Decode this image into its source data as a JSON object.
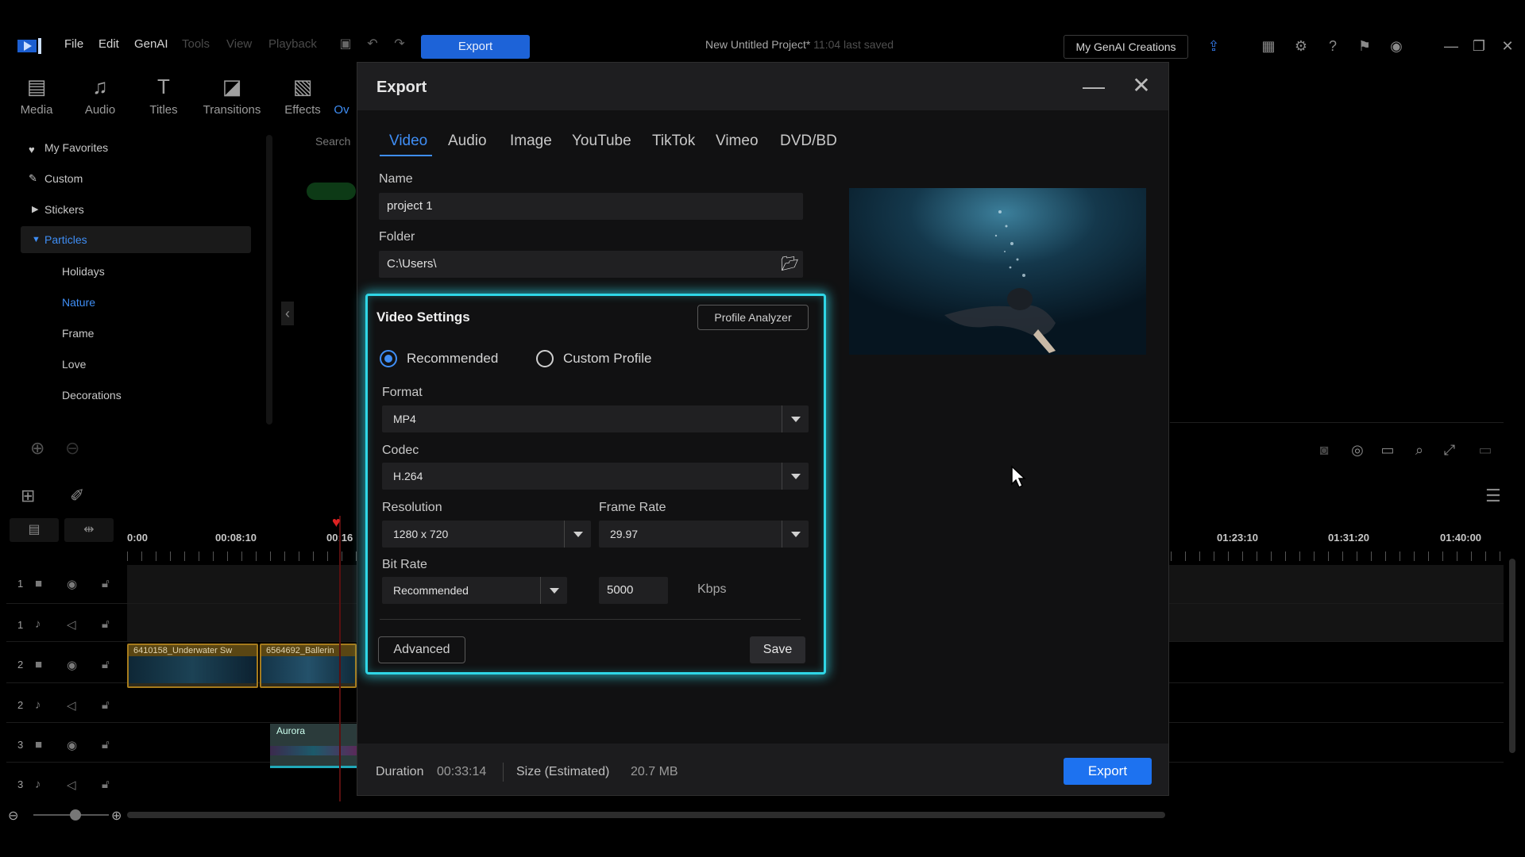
{
  "menu": {
    "file": "File",
    "edit": "Edit",
    "genai": "GenAI",
    "tools": "Tools",
    "view": "View",
    "playback": "Playback",
    "export_button": "Export"
  },
  "project": {
    "title": "New Untitled Project*",
    "saved": "11:04 last saved"
  },
  "genai_creations": "My GenAI Creations",
  "toolbar_tabs": [
    "Media",
    "Audio",
    "Titles",
    "Transitions",
    "Effects",
    "Ov"
  ],
  "left_panel": {
    "favorites": "My Favorites",
    "custom": "Custom",
    "stickers": "Stickers",
    "particles": "Particles",
    "subs": [
      "Holidays",
      "Nature",
      "Frame",
      "Love",
      "Decorations"
    ],
    "search_placeholder": "Search"
  },
  "timeline": {
    "ruler": [
      "0:00",
      "00:08:10",
      "00:16",
      "01:23:10",
      "01:31:20",
      "01:40:00"
    ],
    "track_numbers": [
      "1",
      "1",
      "2",
      "2",
      "3",
      "3"
    ],
    "clips": [
      "6410158_Underwater Sw",
      "6564692_Ballerin",
      "Aurora"
    ]
  },
  "export_dialog": {
    "title": "Export",
    "tabs": [
      "Video",
      "Audio",
      "Image",
      "YouTube",
      "TikTok",
      "Vimeo",
      "DVD/BD"
    ],
    "name_label": "Name",
    "name_value": "project 1",
    "folder_label": "Folder",
    "folder_value": "C:\\Users\\",
    "video_settings": {
      "title": "Video Settings",
      "profile_analyzer": "Profile Analyzer",
      "recommended": "Recommended",
      "custom_profile": "Custom Profile",
      "format_label": "Format",
      "format_value": "MP4",
      "codec_label": "Codec",
      "codec_value": "H.264",
      "resolution_label": "Resolution",
      "resolution_value": "1280 x 720",
      "frame_rate_label": "Frame Rate",
      "frame_rate_value": "29.97",
      "bit_rate_label": "Bit Rate",
      "bit_rate_mode": "Recommended",
      "bit_rate_value": "5000",
      "bit_rate_unit": "Kbps",
      "advanced": "Advanced",
      "save": "Save"
    },
    "footer": {
      "duration_label": "Duration",
      "duration_value": "00:33:14",
      "size_label": "Size (Estimated)",
      "size_value": "20.7 MB",
      "export": "Export"
    }
  },
  "colors": {
    "accent_blue": "#1d72f0",
    "highlight_cyan": "#2fd6e6",
    "active_text": "#3f8ef5"
  }
}
